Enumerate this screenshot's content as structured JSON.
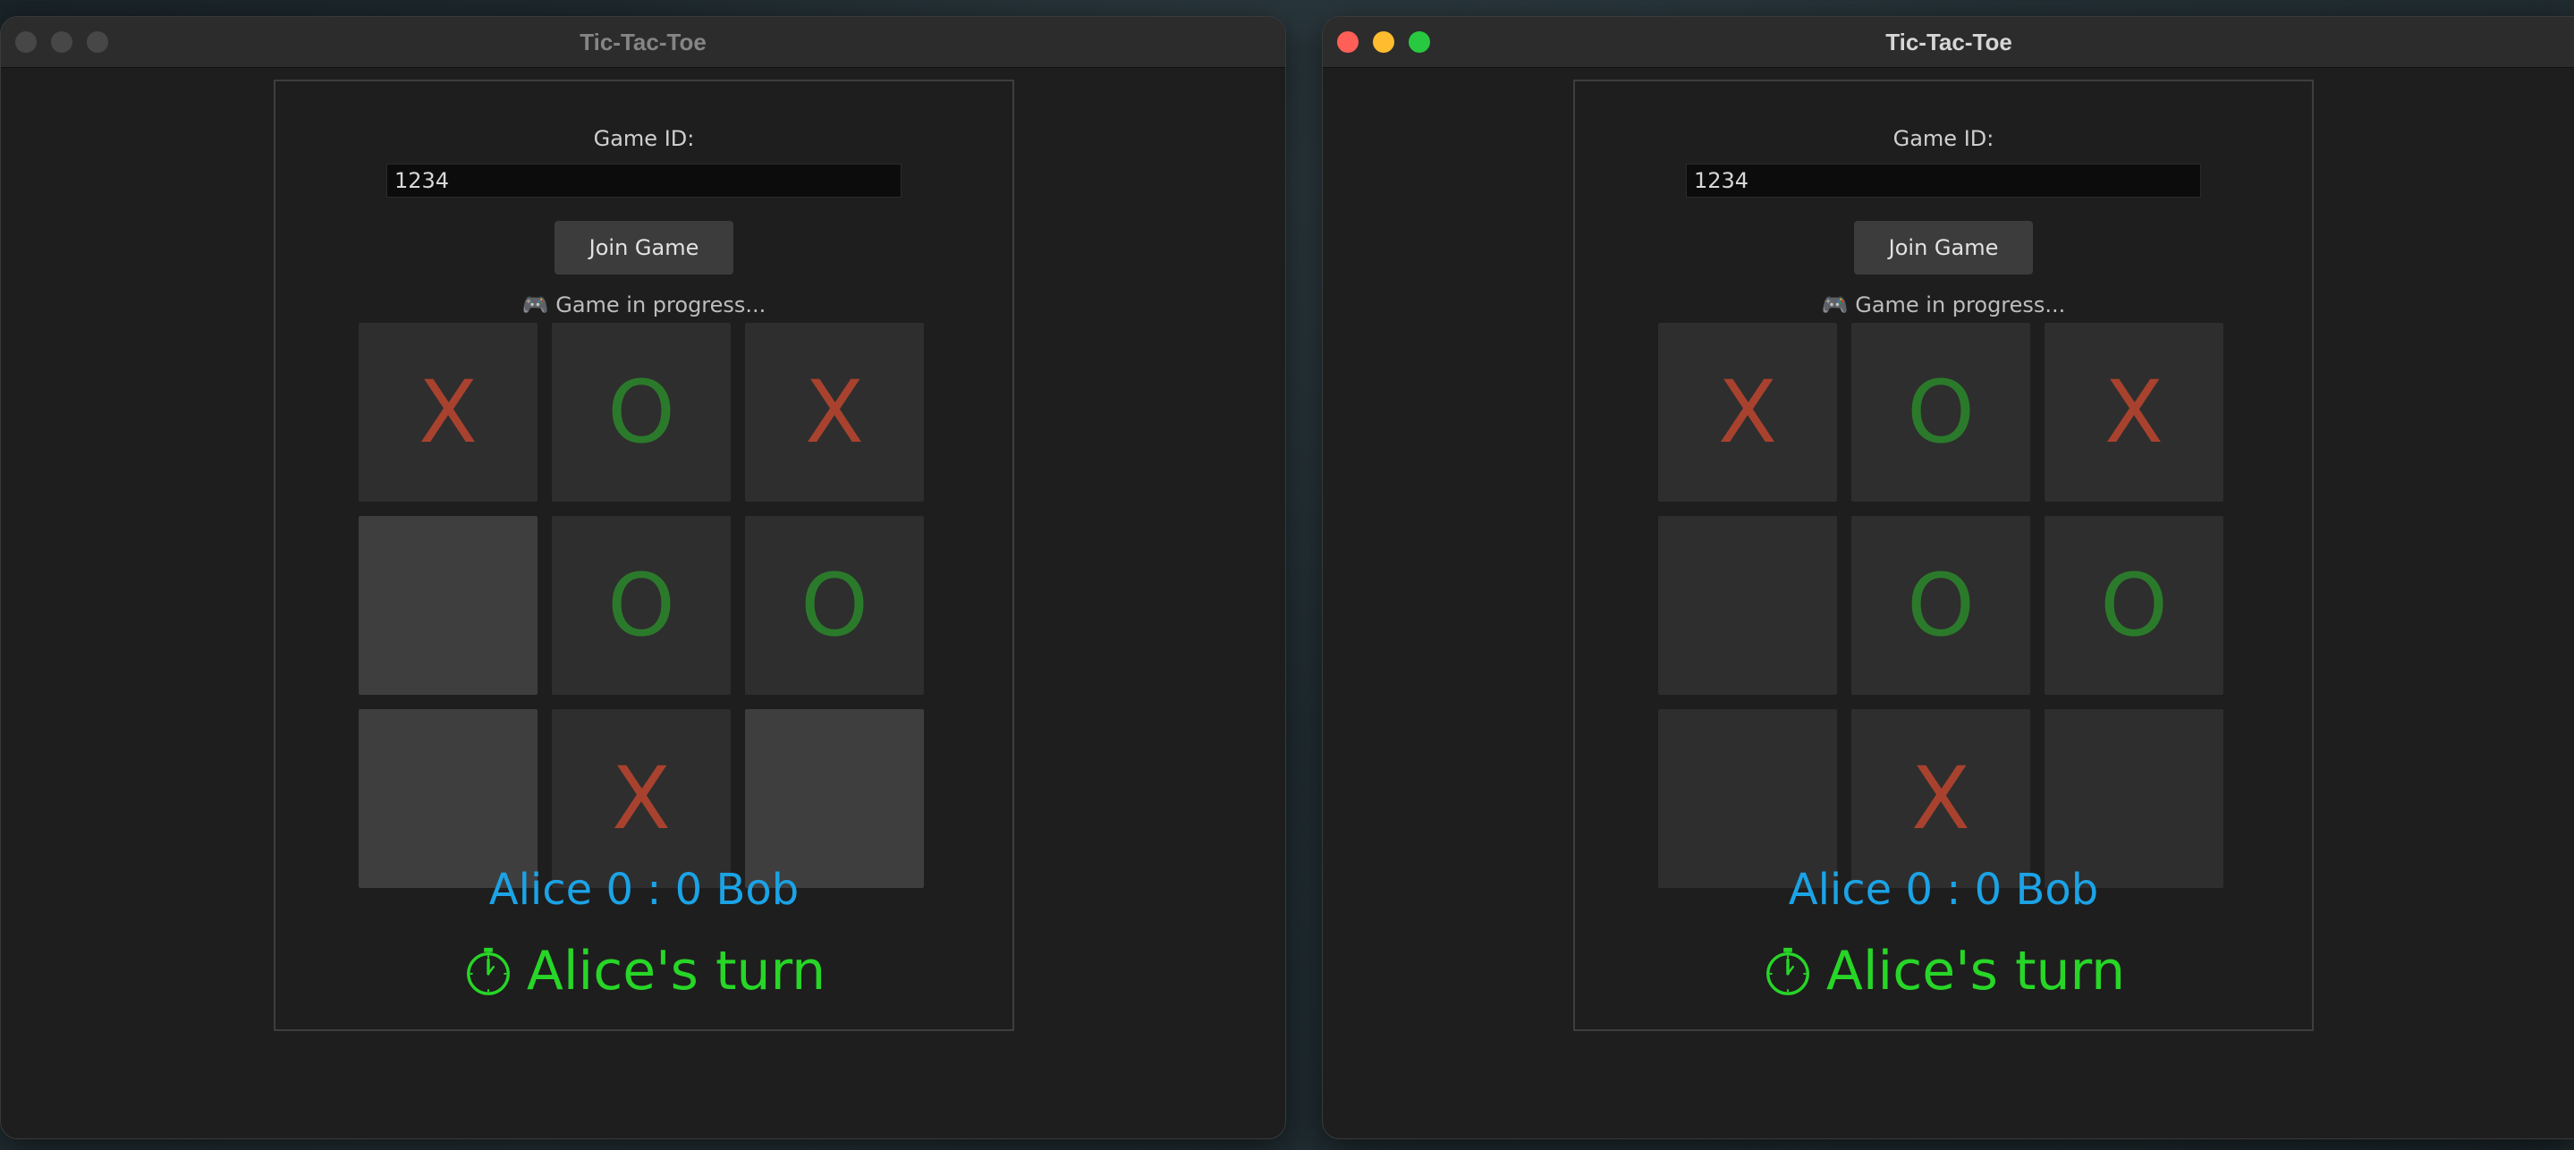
{
  "windows": [
    {
      "title": "Tic-Tac-Toe",
      "state": "inactive",
      "game_id_label": "Game ID:",
      "game_id_value": "1234",
      "join_label": "Join Game",
      "status_icon": "🎮",
      "status_text": "Game in progress...",
      "score_text": "Alice 0 : 0 Bob",
      "turn_icon": "stopwatch-icon",
      "turn_text": "Alice's turn",
      "board": [
        "X",
        "O",
        "X",
        "",
        "O",
        "O",
        "",
        "X",
        ""
      ]
    },
    {
      "title": "Tic-Tac-Toe",
      "state": "active",
      "game_id_label": "Game ID:",
      "game_id_value": "1234",
      "join_label": "Join Game",
      "status_icon": "🎮",
      "status_text": "Game in progress...",
      "score_text": "Alice 0 : 0 Bob",
      "turn_icon": "stopwatch-icon",
      "turn_text": "Alice's turn",
      "board": [
        "X",
        "O",
        "X",
        "",
        "O",
        "O",
        "",
        "X",
        ""
      ]
    }
  ],
  "colors": {
    "x_mark": "#a8422e",
    "o_mark": "#2b7a2b",
    "score": "#1ba3e6",
    "turn": "#27d627",
    "close": "#ff5f57",
    "minimize": "#febc2e",
    "zoom": "#28c840"
  }
}
